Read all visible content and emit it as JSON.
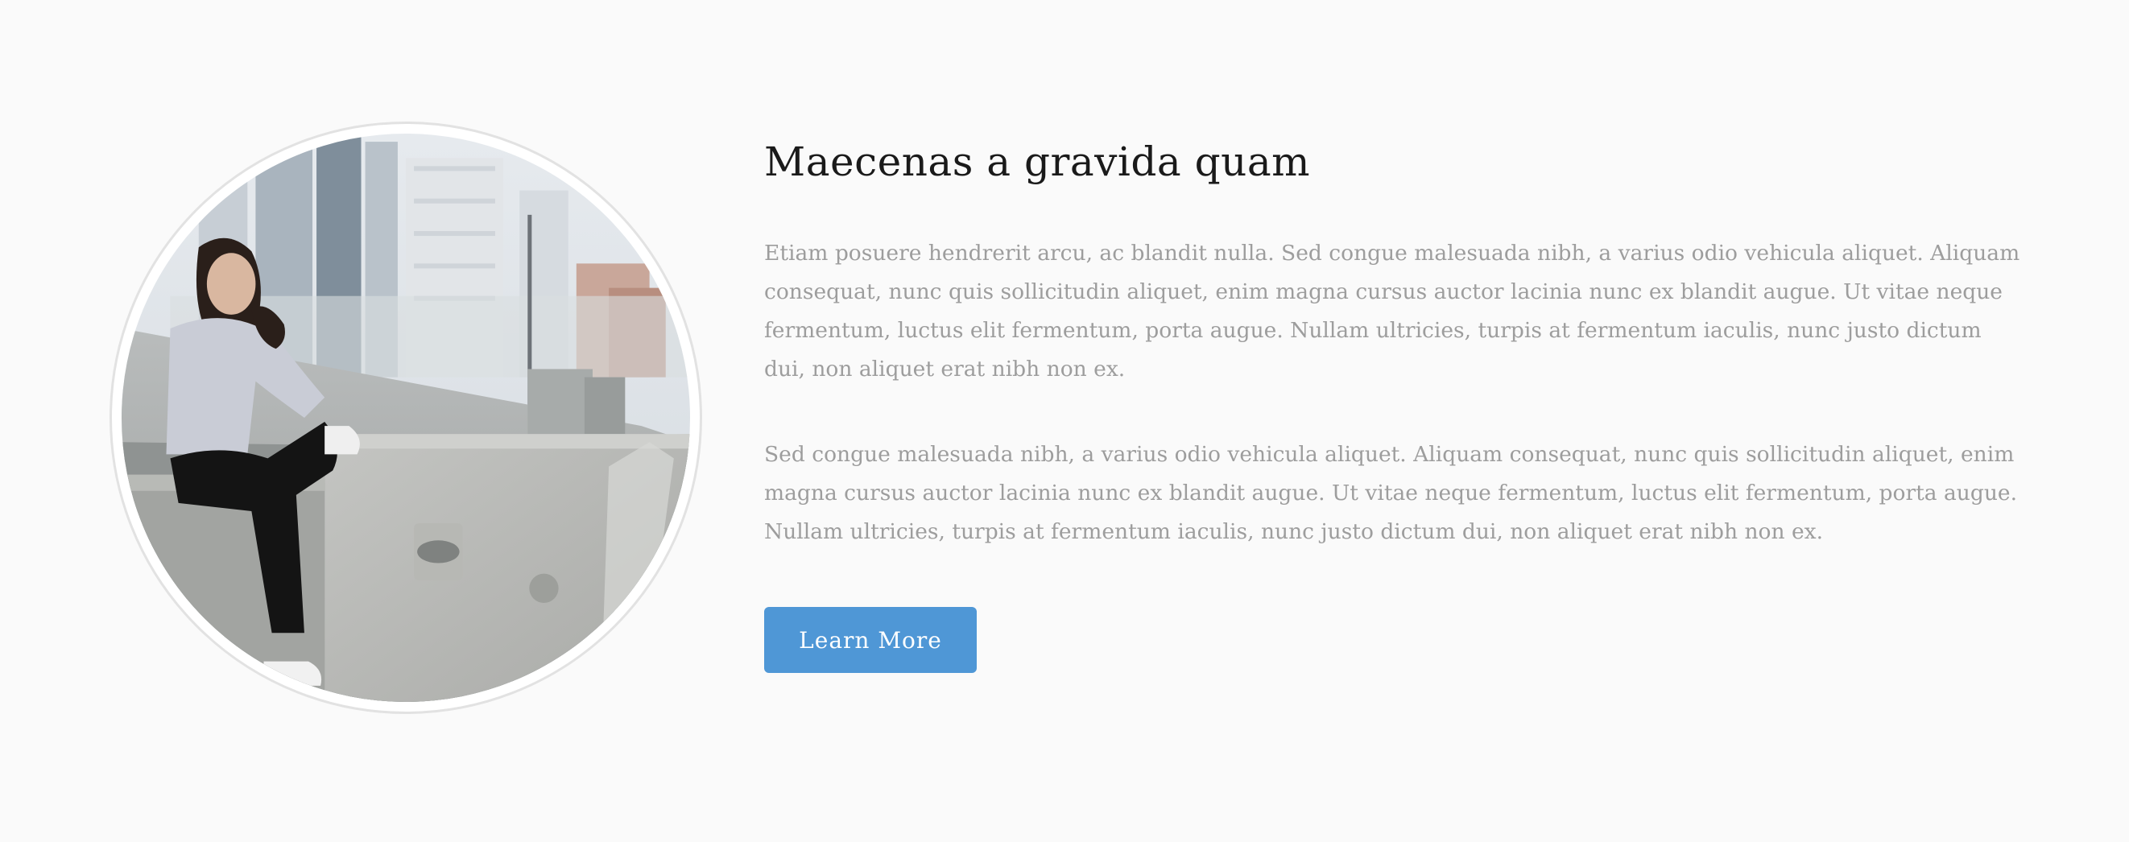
{
  "feature": {
    "image": {
      "alt": "Woman sitting on a concrete rooftop ledge with city skyline behind"
    },
    "title": "Maecenas a gravida quam",
    "paragraphs": [
      "Etiam posuere hendrerit arcu, ac blandit nulla. Sed congue malesuada nibh, a varius odio vehicula aliquet. Aliquam consequat, nunc quis sollicitudin aliquet, enim magna cursus auctor lacinia nunc ex blandit augue. Ut vitae neque fermentum, luctus elit fermentum, porta augue. Nullam ultricies, turpis at fermentum iaculis, nunc justo dictum dui, non aliquet erat nibh non ex.",
      "Sed congue malesuada nibh, a varius odio vehicula aliquet. Aliquam consequat, nunc quis sollicitudin aliquet, enim magna cursus auctor lacinia nunc ex blandit augue. Ut vitae neque fermentum, luctus elit fermentum, porta augue. Nullam ultricies, turpis at fermentum iaculis, nunc justo dictum dui, non aliquet erat nibh non ex."
    ],
    "button_label": "Learn More"
  },
  "colors": {
    "background": "#fafafa",
    "title": "#1a1a1a",
    "body_text": "#9d9d9d",
    "button": "#4f97d6",
    "button_text": "#ffffff"
  }
}
